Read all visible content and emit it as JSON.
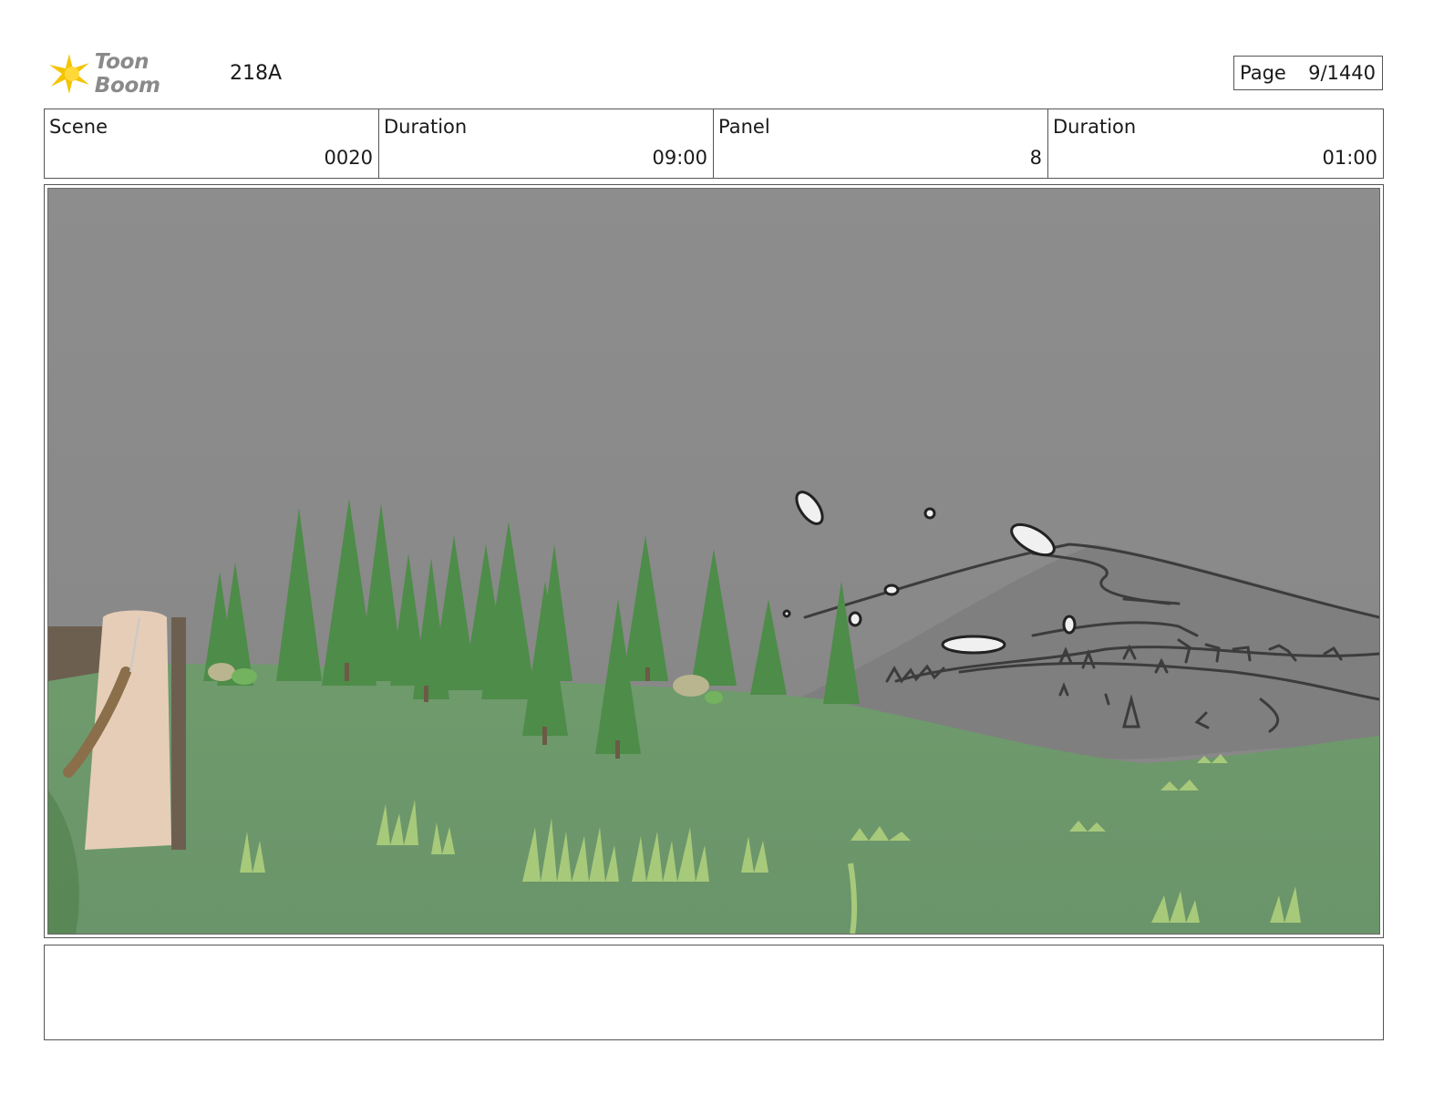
{
  "header": {
    "logo_text": "Toon Boom",
    "project_id": "218A",
    "page_label": "Page",
    "page_value": "9/1440"
  },
  "info": {
    "scene_label": "Scene",
    "scene_value": "0020",
    "duration_label": "Duration",
    "duration_value": "09:00",
    "panel_label": "Panel",
    "panel_value": "8",
    "panel_duration_label": "Duration",
    "panel_duration_value": "01:00"
  },
  "panel": {
    "image_semantic": "storyboard-frame-forest-meadow",
    "sky_color": "#8a8a8a",
    "grass_color": "#6f9a6b",
    "tree_color": "#4f8f4a"
  },
  "notes": {
    "text": ""
  }
}
